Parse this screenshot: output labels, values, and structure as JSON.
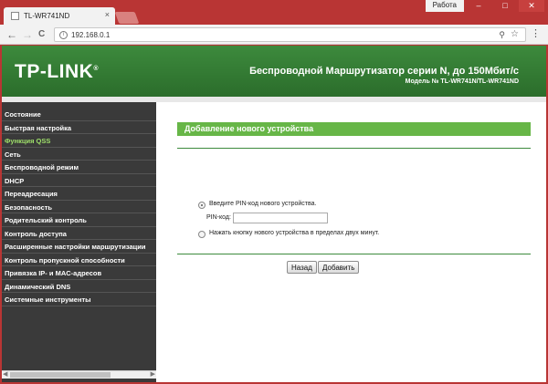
{
  "browser": {
    "tab_title": "TL-WR741ND",
    "tab_close": "×",
    "profile_label": "Работа",
    "win_min": "–",
    "win_max": "□",
    "win_close": "✕",
    "url": "192.168.0.1",
    "nav_back": "←",
    "nav_forward": "→",
    "nav_reload": "C"
  },
  "header": {
    "logo": "TP-LINK",
    "title": "Беспроводной Маршрутизатор серии N, до 150Мбит/с",
    "model": "Модель № TL-WR741N/TL-WR741ND"
  },
  "sidebar": {
    "items": [
      {
        "label": "Состояние",
        "active": false
      },
      {
        "label": "Быстрая настройка",
        "active": false
      },
      {
        "label": "Функция QSS",
        "active": true
      },
      {
        "label": "Сеть",
        "active": false
      },
      {
        "label": "Беспроводной режим",
        "active": false
      },
      {
        "label": "DHCP",
        "active": false
      },
      {
        "label": "Переадресация",
        "active": false
      },
      {
        "label": "Безопасность",
        "active": false
      },
      {
        "label": "Родительский контроль",
        "active": false
      },
      {
        "label": "Контроль доступа",
        "active": false
      },
      {
        "label": "Расширенные настройки маршрутизации",
        "active": false
      },
      {
        "label": "Контроль пропускной способности",
        "active": false
      },
      {
        "label": "Привязка IP- и MAC-адресов",
        "active": false
      },
      {
        "label": "Динамический DNS",
        "active": false
      },
      {
        "label": "Системные инструменты",
        "active": false
      }
    ]
  },
  "main": {
    "section_title": "Добавление нового устройства",
    "option_pin_label": "Введите PIN-код нового устройства.",
    "pin_field_label": "PIN-код:",
    "pin_value": "",
    "option_button_label": "Нажать кнопку нового устройства в пределах двух минут.",
    "back_button": "Назад",
    "add_button": "Добавить"
  },
  "colors": {
    "brand_green": "#3d8a3d",
    "section_green": "#67b647",
    "sidebar_bg": "#3a3a3a",
    "active_item": "#9fe06a",
    "browser_frame": "#b93534"
  }
}
